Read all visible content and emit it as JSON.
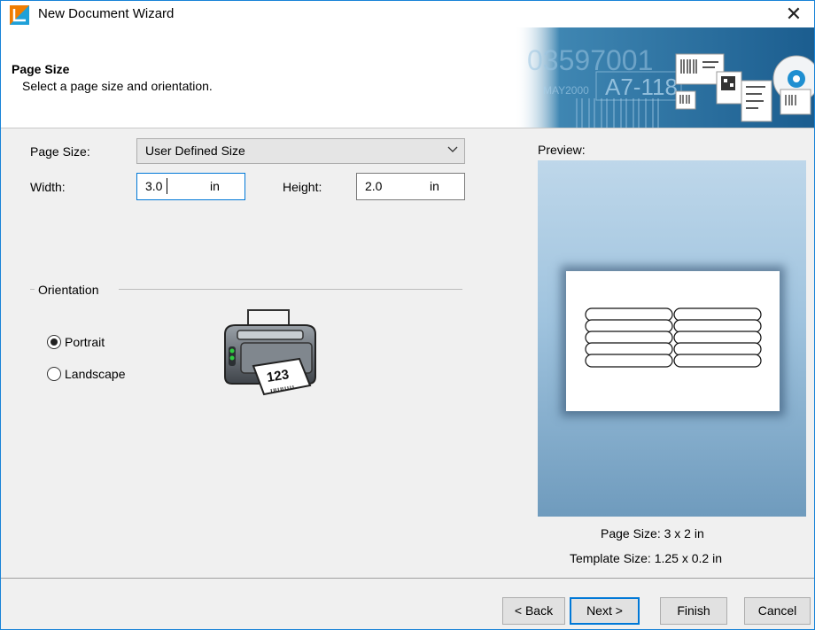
{
  "window": {
    "title": "New Document Wizard",
    "close_glyph": "✕"
  },
  "header": {
    "title": "Page Size",
    "subtitle": "Select a page size and orientation."
  },
  "form": {
    "page_size_label": "Page Size:",
    "page_size_value": "User Defined Size",
    "width_label": "Width:",
    "width_value": "3.0",
    "width_unit": "in",
    "height_label": "Height:",
    "height_value": "2.0",
    "height_unit": "in"
  },
  "orientation": {
    "group_label": "Orientation",
    "options": [
      {
        "label": "Portrait",
        "selected": true
      },
      {
        "label": "Landscape",
        "selected": false
      }
    ]
  },
  "printer_paper_text": "123",
  "banner_text": {
    "number": "03597001",
    "code": "A7-118",
    "date": "MAY2000"
  },
  "preview": {
    "label": "Preview:",
    "page_size_text": "Page Size:  3 x 2 in",
    "template_size_text": "Template Size:  1.25 x 0.2 in",
    "label_rows": 5,
    "label_cols": 2
  },
  "buttons": {
    "back": "< Back",
    "next": "Next >",
    "finish": "Finish",
    "cancel": "Cancel"
  },
  "colors": {
    "accent": "#0078d7",
    "logo_orange": "#f07d00",
    "logo_blue": "#1fa0d8",
    "preview_top": "#bed7ea",
    "preview_bottom": "#6f9bbd"
  }
}
